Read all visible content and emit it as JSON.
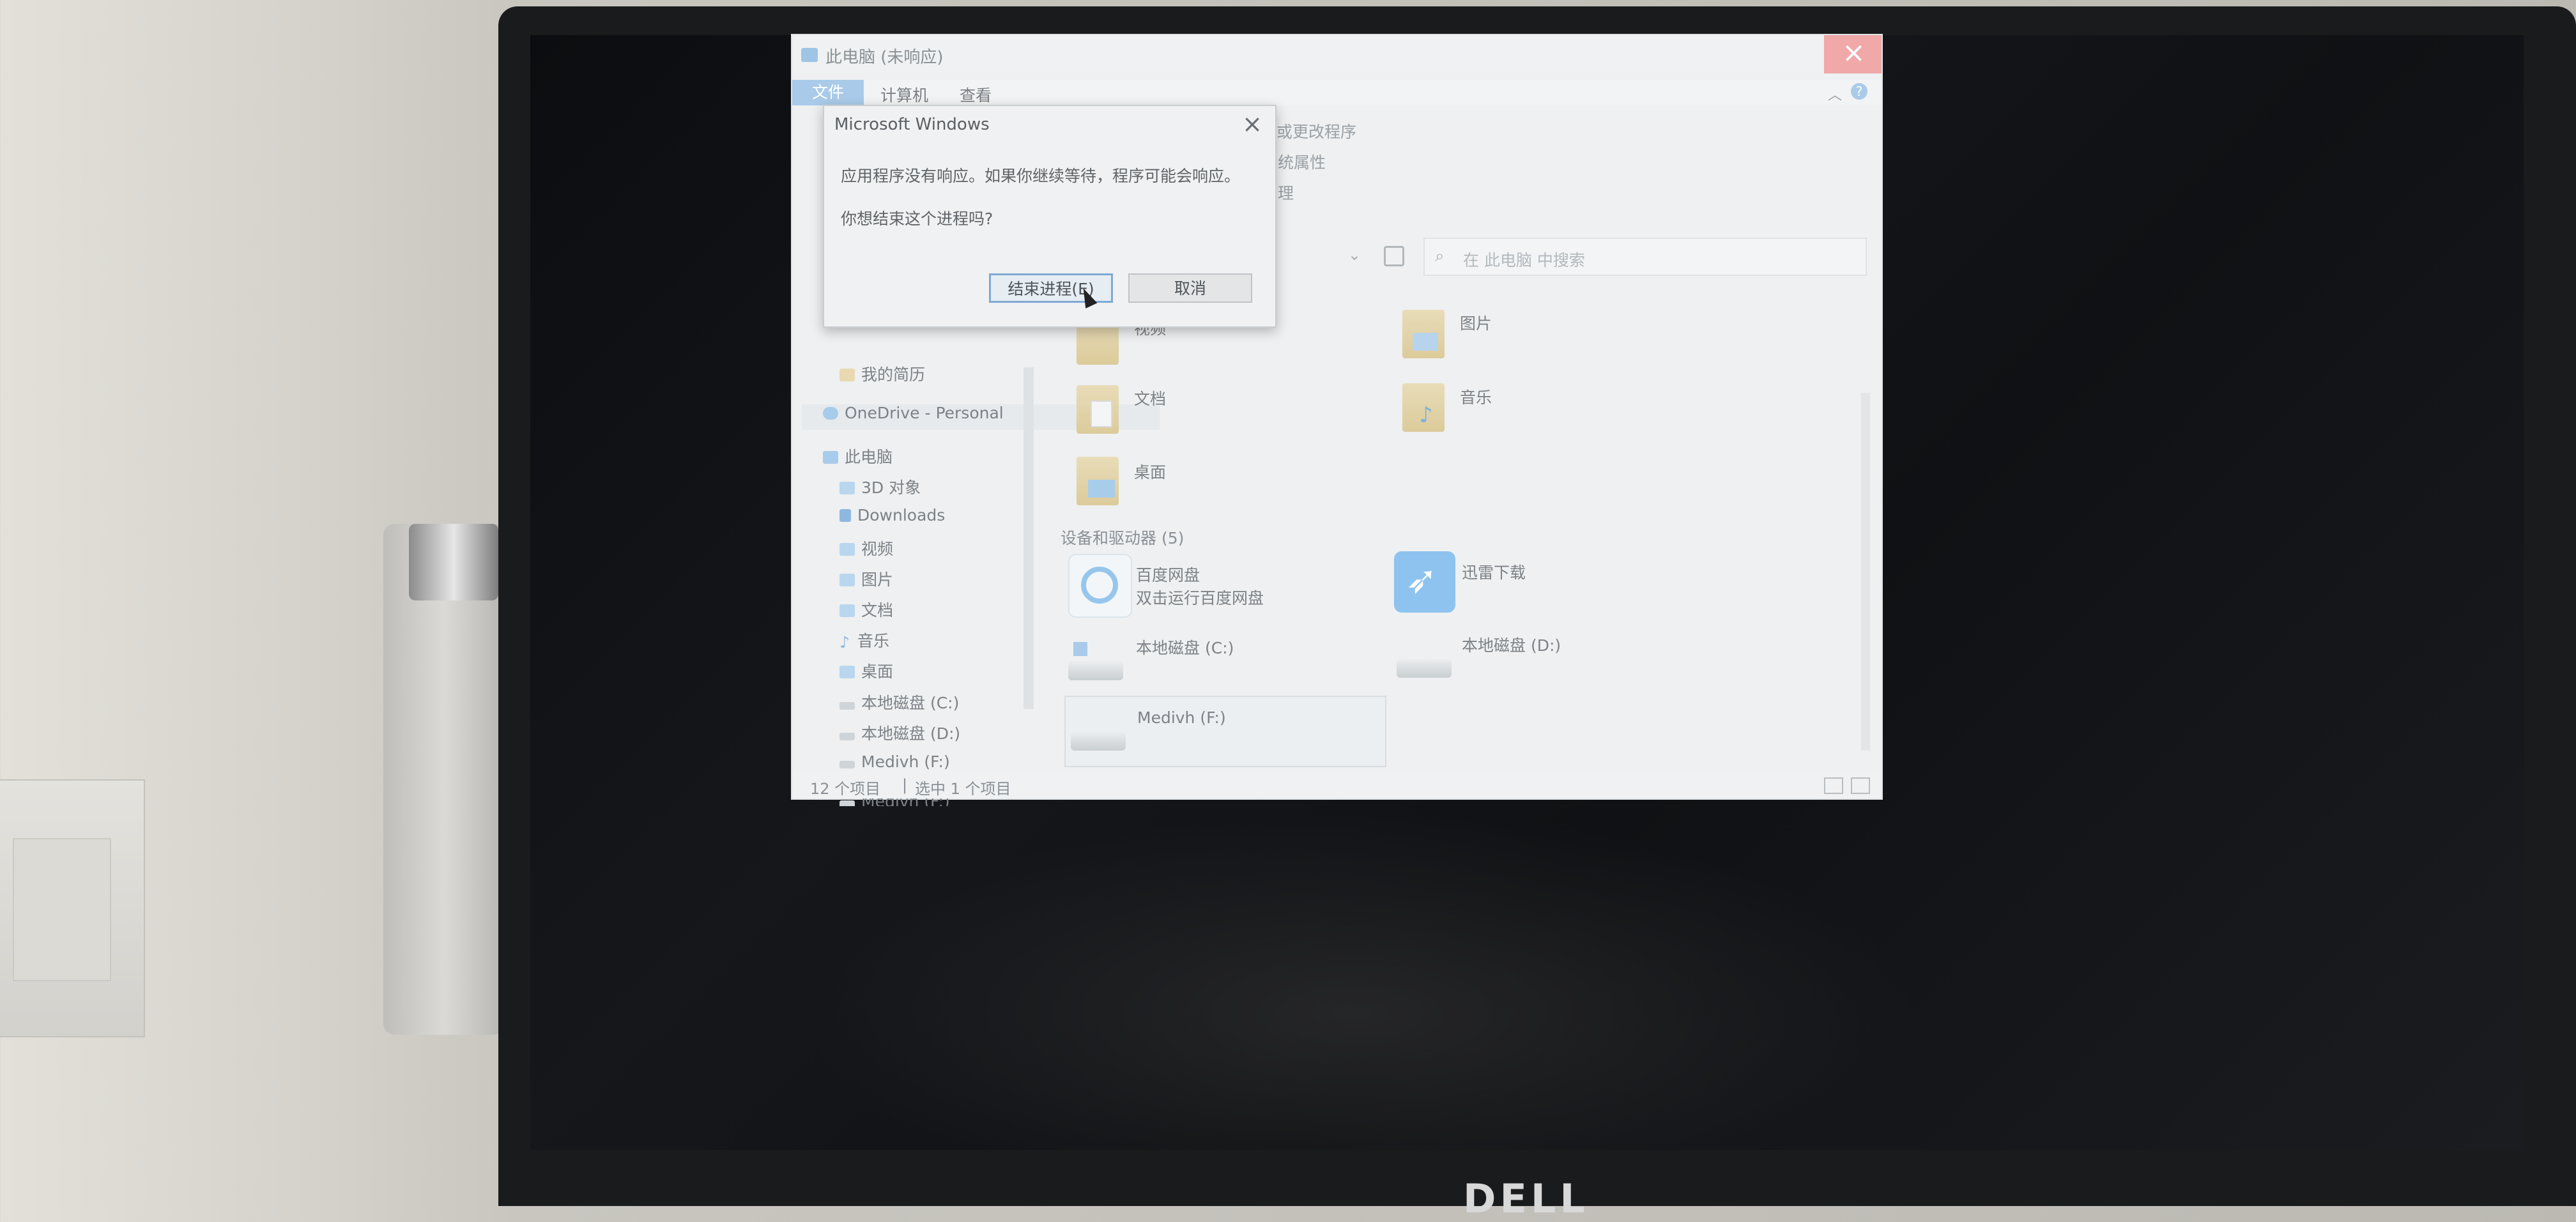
{
  "brand": "DELL",
  "window": {
    "title": "此电脑 (未响应)",
    "ribbon_tabs": [
      "文件",
      "计算机",
      "查看"
    ],
    "ribbon_fragments": [
      "或更改程序",
      "统属性",
      "理"
    ],
    "search_placeholder": "在 此电脑 中搜索"
  },
  "dialog": {
    "title": "Microsoft Windows",
    "message": "应用程序没有响应。如果你继续等待，程序可能会响应。",
    "question": "你想结束这个进程吗?",
    "end_button": "结束进程(E)",
    "cancel_button": "取消"
  },
  "nav": {
    "items": [
      {
        "label": "我的简历",
        "icon": "folder-icon"
      },
      {
        "label": "OneDrive - Personal",
        "icon": "cloud-icon"
      },
      {
        "label": "此电脑",
        "icon": "pc-icon"
      },
      {
        "label": "3D 对象",
        "icon": "cube-icon"
      },
      {
        "label": "Downloads",
        "icon": "download-icon"
      },
      {
        "label": "视频",
        "icon": "video-icon"
      },
      {
        "label": "图片",
        "icon": "picture-icon"
      },
      {
        "label": "文档",
        "icon": "document-icon"
      },
      {
        "label": "音乐",
        "icon": "music-icon"
      },
      {
        "label": "桌面",
        "icon": "desktop-icon"
      },
      {
        "label": "本地磁盘 (C:)",
        "icon": "drive-icon"
      },
      {
        "label": "本地磁盘 (D:)",
        "icon": "drive-icon"
      },
      {
        "label": "Medivh (F:)",
        "icon": "drive-icon"
      },
      {
        "label": "Medivh (F:)",
        "icon": "drive-icon"
      }
    ]
  },
  "content": {
    "folders": [
      {
        "label": "视频"
      },
      {
        "label": "图片"
      },
      {
        "label": "文档"
      },
      {
        "label": "音乐"
      },
      {
        "label": "桌面"
      }
    ],
    "devices_header": "设备和驱动器 (5)",
    "devices": [
      {
        "label": "百度网盘",
        "sub": "双击运行百度网盘"
      },
      {
        "label": "迅雷下载",
        "sub": ""
      },
      {
        "label": "本地磁盘 (C:)",
        "sub": ""
      },
      {
        "label": "本地磁盘 (D:)",
        "sub": ""
      },
      {
        "label": "Medivh (F:)",
        "sub": ""
      }
    ]
  },
  "status": {
    "count": "12 个项目",
    "selected": "选中 1 个项目"
  }
}
